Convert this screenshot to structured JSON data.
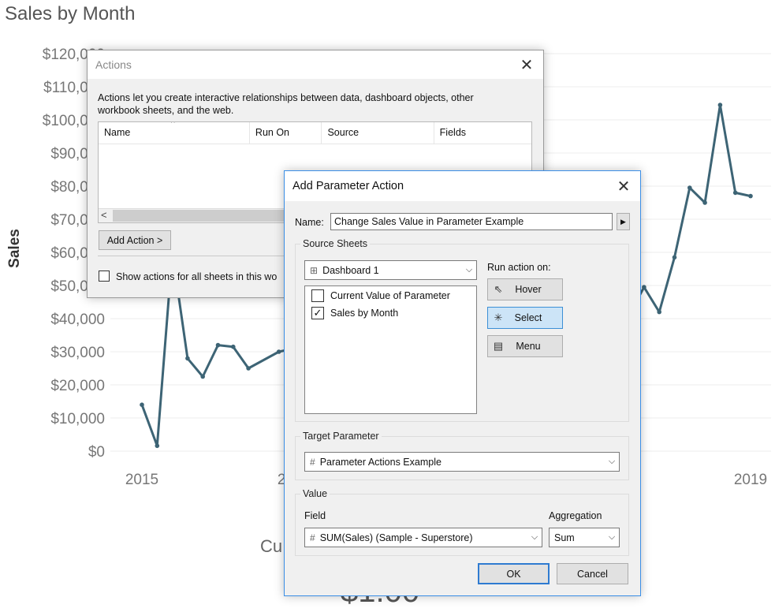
{
  "chart_data": {
    "type": "line",
    "title": "Sales by Month",
    "ylabel": "Sales",
    "ylim": [
      0,
      120000
    ],
    "y_ticks": [
      "$0",
      "$10,000",
      "$20,000",
      "$30,000",
      "$40,000",
      "$50,000",
      "$60,000",
      "$70,000",
      "$80,000",
      "$90,000",
      "$100,000",
      "$110,000",
      "$120,000"
    ],
    "x_ticks": [
      "2015",
      "2016",
      "2019"
    ],
    "x_tick_values": [
      2015,
      2016,
      2019
    ],
    "series": [
      {
        "color": "#3d6475",
        "x": [
          2015.0,
          2015.1,
          2015.2,
          2015.3,
          2015.4,
          2015.5,
          2015.6,
          2015.7,
          2015.9,
          2016.0,
          2016.1,
          2018.1,
          2018.2,
          2018.3,
          2018.4,
          2018.5,
          2018.6,
          2018.7,
          2018.8,
          2018.9,
          2019.0
        ],
        "y": [
          14000,
          1600,
          60000,
          28000,
          22500,
          32000,
          31500,
          25000,
          30000,
          31000,
          75000,
          35000,
          41000,
          49500,
          42000,
          58500,
          79500,
          75000,
          104500,
          78000,
          77000
        ]
      }
    ]
  },
  "chart": {
    "title": "Sales by Month",
    "y_axis_title": "Sales",
    "hidden_label_fragment": "Cu",
    "hidden_value_fragment": "$1.00"
  },
  "actions_dialog": {
    "title": "Actions",
    "description": "Actions let you create interactive relationships between data, dashboard objects, other workbook sheets, and the web.",
    "columns": [
      "Name",
      "Run On",
      "Source",
      "Fields"
    ],
    "add_action_label": "Add Action >",
    "show_all_label": "Show actions for all sheets in this wo"
  },
  "param_dialog": {
    "title": "Add Parameter Action",
    "name_label": "Name:",
    "name_value": "Change Sales Value in Parameter Example",
    "source_sheets_label": "Source Sheets",
    "source_dropdown": "Dashboard 1",
    "sheets": [
      {
        "label": "Current Value of Parameter",
        "checked": false
      },
      {
        "label": "Sales by Month",
        "checked": true
      }
    ],
    "run_action_label": "Run action on:",
    "run_buttons": [
      {
        "label": "Hover",
        "icon": "pointer-icon",
        "selected": false
      },
      {
        "label": "Select",
        "icon": "click-icon",
        "selected": true
      },
      {
        "label": "Menu",
        "icon": "menu-icon",
        "selected": false
      }
    ],
    "target_parameter_label": "Target Parameter",
    "target_parameter_value": "Parameter Actions Example",
    "value_label": "Value",
    "field_label": "Field",
    "field_value": "SUM(Sales) (Sample - Superstore)",
    "aggregation_label": "Aggregation",
    "aggregation_value": "Sum",
    "ok_label": "OK",
    "cancel_label": "Cancel"
  }
}
